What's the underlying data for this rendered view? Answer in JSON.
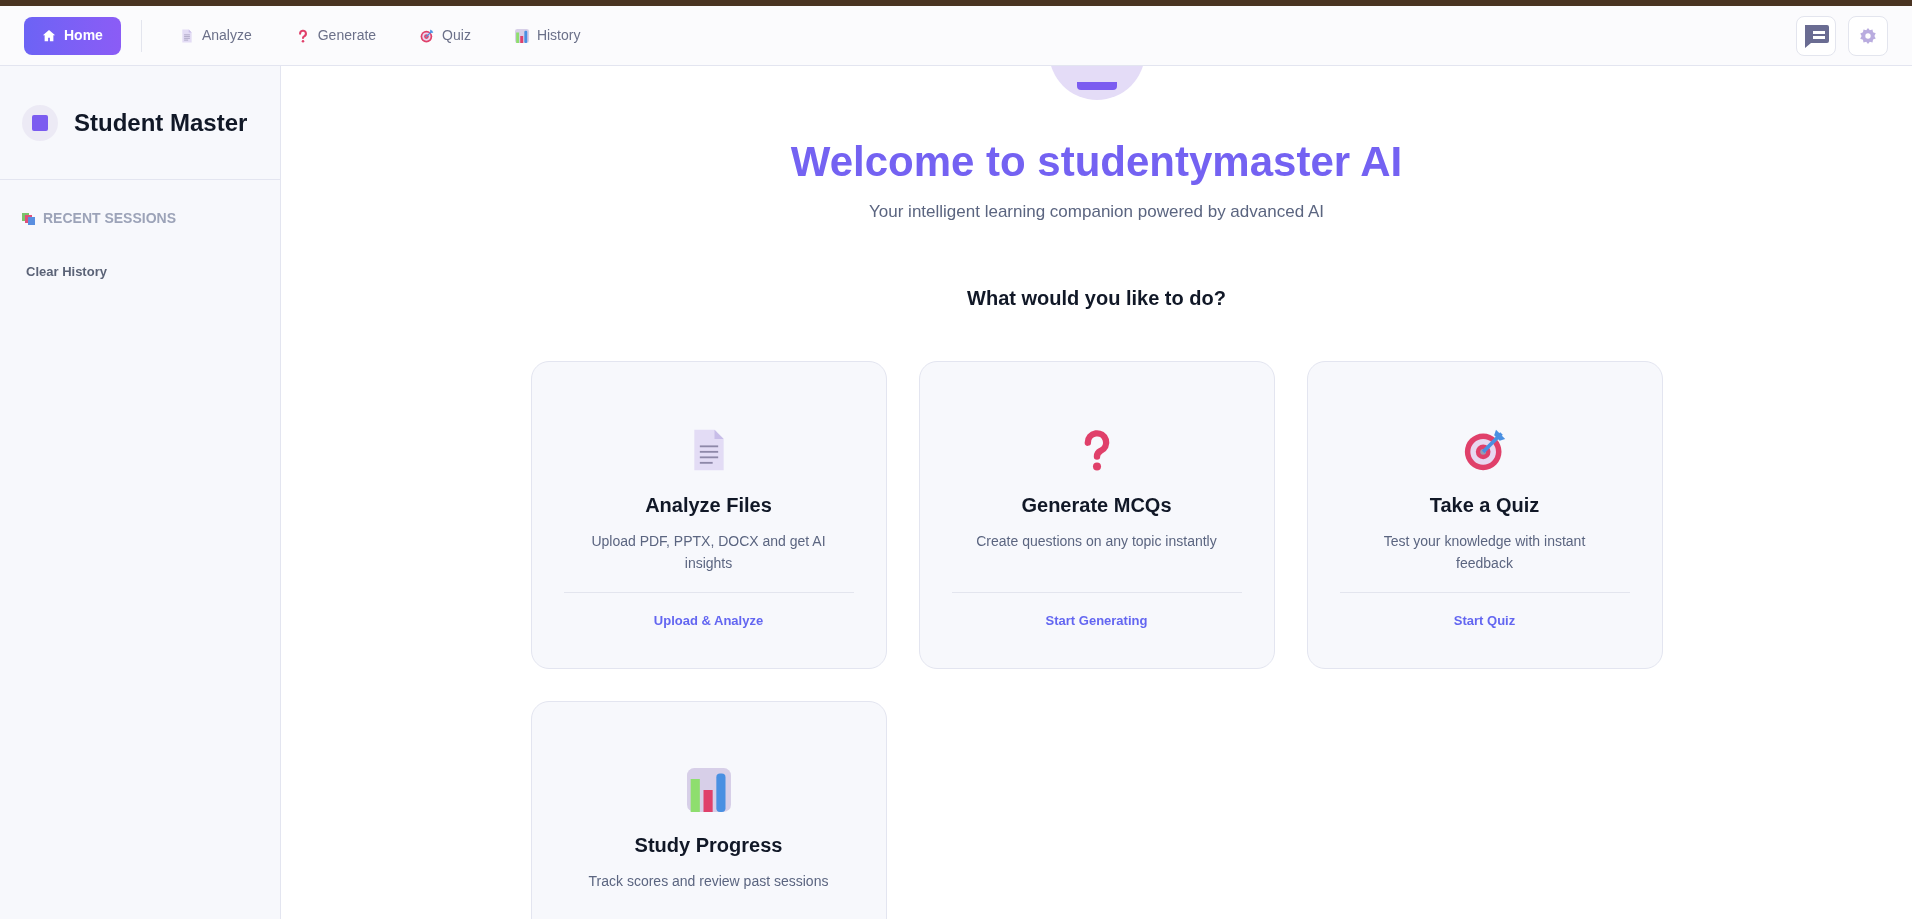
{
  "nav": {
    "tabs": [
      {
        "label": "Home",
        "kind": "house",
        "selected": true
      },
      {
        "label": "Analyze",
        "kind": "document",
        "selected": false
      },
      {
        "label": "Generate",
        "kind": "question",
        "selected": false
      },
      {
        "label": "Quiz",
        "kind": "target",
        "selected": false
      },
      {
        "label": "History",
        "kind": "chart",
        "selected": false
      }
    ]
  },
  "sidebar": {
    "title": "Student Master",
    "section_heading": "RECENT SESSIONS",
    "clear_button": "Clear History"
  },
  "main": {
    "title": "Welcome to studentymaster AI",
    "subtitle": "Your intelligent learning companion powered by advanced AI",
    "prompt": "What would you like to do?",
    "cards": [
      {
        "kind": "document",
        "title": "Analyze Files",
        "description": "Upload PDF, PPTX, DOCX and get AI insights",
        "action": "Upload & Analyze"
      },
      {
        "kind": "question",
        "title": "Generate MCQs",
        "description": "Create questions on any topic instantly",
        "action": "Start Generating"
      },
      {
        "kind": "target",
        "title": "Take a Quiz",
        "description": "Test your knowledge with instant feedback",
        "action": "Start Quiz"
      },
      {
        "kind": "chart",
        "title": "Study Progress",
        "description": "Track scores and review past sessions"
      }
    ]
  }
}
